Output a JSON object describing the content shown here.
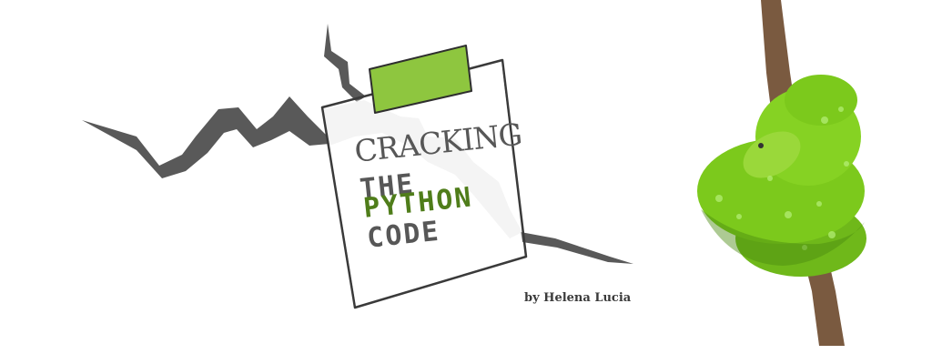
{
  "title": {
    "line1": "CRACKING",
    "line2": "THE",
    "line3": "PYTHON",
    "line4": "CODE"
  },
  "byline": "by Helena Lucia",
  "colors": {
    "background": "#ffffff",
    "crack": "#595959",
    "crack_light": "#e6e6e6",
    "title_dark": "#575757",
    "title_accent": "#4f7d1a",
    "tape": "#8ec63f",
    "note_outline": "#3a3a3a",
    "snake": "#7cc91c",
    "branch": "#7a5a40"
  },
  "icons": {
    "note": "sticky-note-icon",
    "crack": "wall-crack-icon",
    "snake": "green-python-snake-icon"
  }
}
